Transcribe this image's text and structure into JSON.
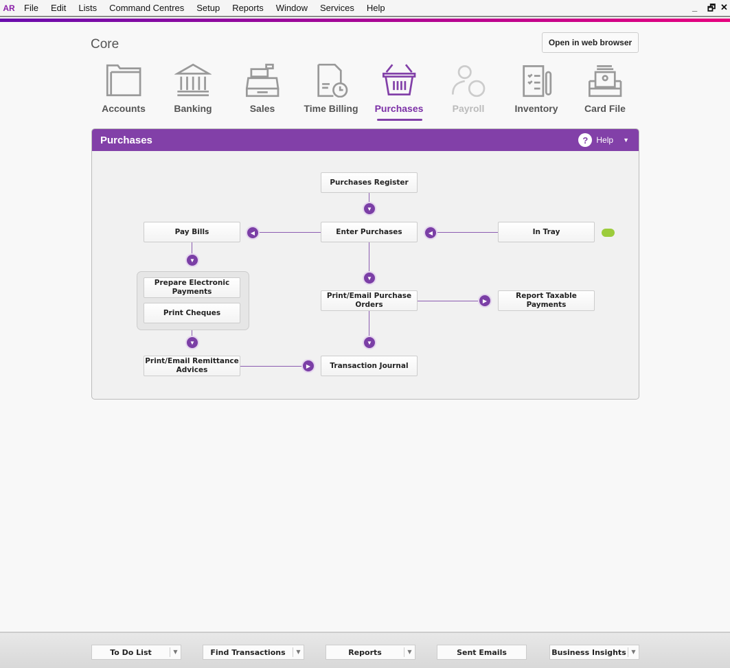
{
  "app_logo": "AR",
  "menu": [
    "File",
    "Edit",
    "Lists",
    "Command Centres",
    "Setup",
    "Reports",
    "Window",
    "Services",
    "Help"
  ],
  "window_controls": {
    "minimize": "_",
    "restore": "🗗",
    "close": "✕"
  },
  "company_name": "Core",
  "open_web_label": "Open in web browser",
  "nav": [
    {
      "label": "Accounts",
      "icon": "folder-icon"
    },
    {
      "label": "Banking",
      "icon": "bank-icon"
    },
    {
      "label": "Sales",
      "icon": "cash-register-icon"
    },
    {
      "label": "Time Billing",
      "icon": "invoice-clock-icon"
    },
    {
      "label": "Purchases",
      "icon": "basket-icon",
      "active": true
    },
    {
      "label": "Payroll",
      "icon": "person-dollar-icon",
      "disabled": true
    },
    {
      "label": "Inventory",
      "icon": "checklist-icon"
    },
    {
      "label": "Card File",
      "icon": "card-tray-icon"
    }
  ],
  "panel": {
    "title": "Purchases",
    "help_label": "Help",
    "help_icon": "?",
    "boxes": {
      "purchases_register": "Purchases Register",
      "pay_bills": "Pay Bills",
      "enter_purchases": "Enter Purchases",
      "in_tray": "In Tray",
      "prepare_electronic_payments": "Prepare Electronic Payments",
      "print_cheques": "Print Cheques",
      "print_email_purchase_orders": "Print/Email Purchase Orders",
      "report_taxable_payments": "Report Taxable Payments",
      "print_email_remittance_advices": "Print/Email Remittance Advices",
      "transaction_journal": "Transaction Journal"
    }
  },
  "bottom": [
    "To Do List",
    "Find Transactions",
    "Reports",
    "Sent Emails",
    "Business Insights"
  ],
  "colors": {
    "accent": "#8240a8",
    "gradient_start": "#6a0dad",
    "gradient_end": "#e6007e",
    "cloud": "#9ccc3c"
  }
}
